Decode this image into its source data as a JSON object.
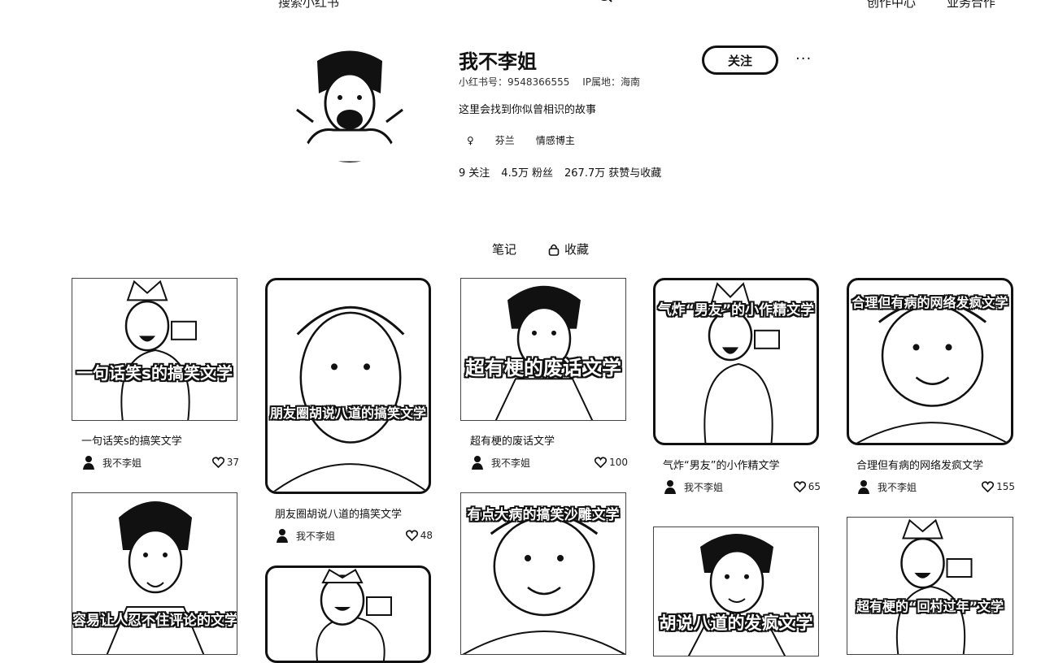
{
  "header": {
    "search_placeholder": "搜索小红书",
    "nav": [
      "创作中心",
      "业务合作"
    ]
  },
  "profile": {
    "name": "我不李姐",
    "id_label": "小红书号：9548366555",
    "ip_label": "IP属地：海南",
    "bio": "这里会找到你似曾相识的故事",
    "tags": [
      {
        "icon": "female-icon",
        "label": "♀"
      },
      {
        "label": "芬兰"
      },
      {
        "label": "情感博主"
      }
    ],
    "stats": [
      {
        "value": "9",
        "label": "关注"
      },
      {
        "value": "4.5万",
        "label": "粉丝"
      },
      {
        "value": "267.7万",
        "label": "获赞与收藏"
      }
    ],
    "follow_label": "关注",
    "more_label": "···"
  },
  "tabs": [
    {
      "label": "笔记",
      "active": true
    },
    {
      "label": "收藏",
      "icon": "lock-icon"
    }
  ],
  "notes": [
    {
      "cover_text": "一句话笑s的搞笑文学",
      "title": "一句话笑s的搞笑文学",
      "author": "我不李姐",
      "likes": "37"
    },
    {
      "cover_text": "朋友圈胡说八道的搞笑文学",
      "title": "朋友圈胡说八道的搞笑文学",
      "author": "我不李姐",
      "likes": "48"
    },
    {
      "cover_text": "超有梗的废话文学",
      "title": "超有梗的废话文学",
      "author": "我不李姐",
      "likes": "100"
    },
    {
      "cover_text": "气炸“男友”的小作精文学",
      "title": "气炸“男友”的小作精文学",
      "author": "我不李姐",
      "likes": "65"
    },
    {
      "cover_text": "合理但有病的网络发疯文学",
      "title": "合理但有病的网络发疯文学",
      "author": "我不李姐",
      "likes": "155"
    },
    {
      "cover_text": "容易让人忍不住评论的文学"
    },
    {
      "cover_text": ""
    },
    {
      "cover_text": "有点大病的搞笑沙雕文学"
    },
    {
      "cover_text": "胡说八道的发疯文学"
    },
    {
      "cover_text": "超有梗的“回村过年”文学"
    }
  ]
}
